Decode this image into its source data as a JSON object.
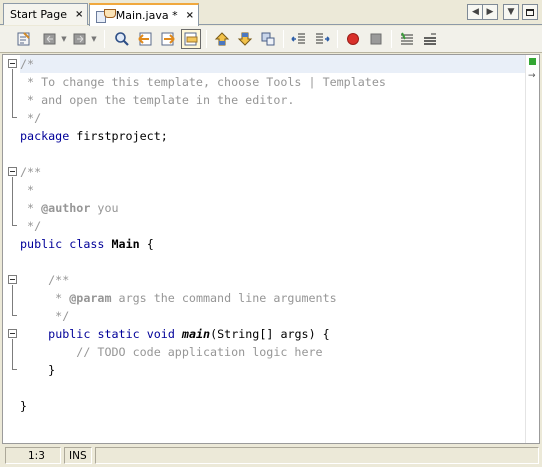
{
  "tabs": [
    {
      "label": "Start Page",
      "close": "×"
    },
    {
      "label": "Main.java *",
      "close": "×"
    }
  ],
  "tab_nav": {
    "left": "◀",
    "right": "▶",
    "menu": "▼"
  },
  "toolbar": {
    "buttons": [
      "last-edit-icon",
      "back-icon",
      "forward-icon",
      "find-selection-icon",
      "find-previous-icon",
      "find-next-icon",
      "toggle-highlight-search-icon",
      "previous-bookmark-icon",
      "next-bookmark-icon",
      "toggle-bookmark-icon",
      "shift-left-icon",
      "shift-right-icon",
      "record-macro-icon",
      "stop-macro-icon",
      "comment-icon",
      "uncomment-icon"
    ]
  },
  "colors": {
    "comment": "#969696",
    "keyword": "#000099",
    "current_line": "#e9eff8",
    "tab_accent": "#f0a83e",
    "record": "#d9302a"
  },
  "editor": {
    "lines": [
      "/*",
      " * To change this template, choose Tools | Templates",
      " * and open the template in the editor.",
      " */",
      "package firstproject;",
      "",
      "/**",
      " *",
      " * @author you",
      " */",
      "public class Main {",
      "",
      "    /**",
      "     * @param args the command line arguments",
      "     */",
      "    public static void main(String[] args) {",
      "        // TODO code application logic here",
      "    }",
      "",
      "}"
    ]
  },
  "status": {
    "position": "1:3",
    "mode": "INS",
    "message": ""
  }
}
